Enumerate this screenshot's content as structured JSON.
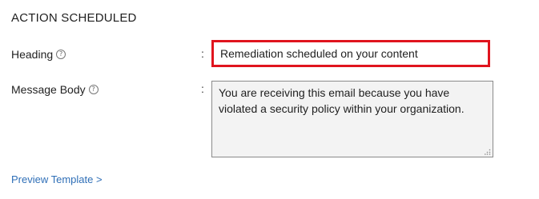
{
  "section": {
    "title": "ACTION SCHEDULED"
  },
  "heading": {
    "label": "Heading",
    "help_icon": "question-circle-icon",
    "colon": ":",
    "value": "Remediation scheduled on your content",
    "highlight_color": "#e0141e"
  },
  "message_body": {
    "label": "Message Body",
    "help_icon": "question-circle-icon",
    "colon": ":",
    "value": "You are receiving this email because you have violated a security policy within your organization."
  },
  "preview": {
    "label": "Preview Template >"
  },
  "colors": {
    "link": "#2f6fb7",
    "textarea_bg": "#f3f3f3"
  }
}
